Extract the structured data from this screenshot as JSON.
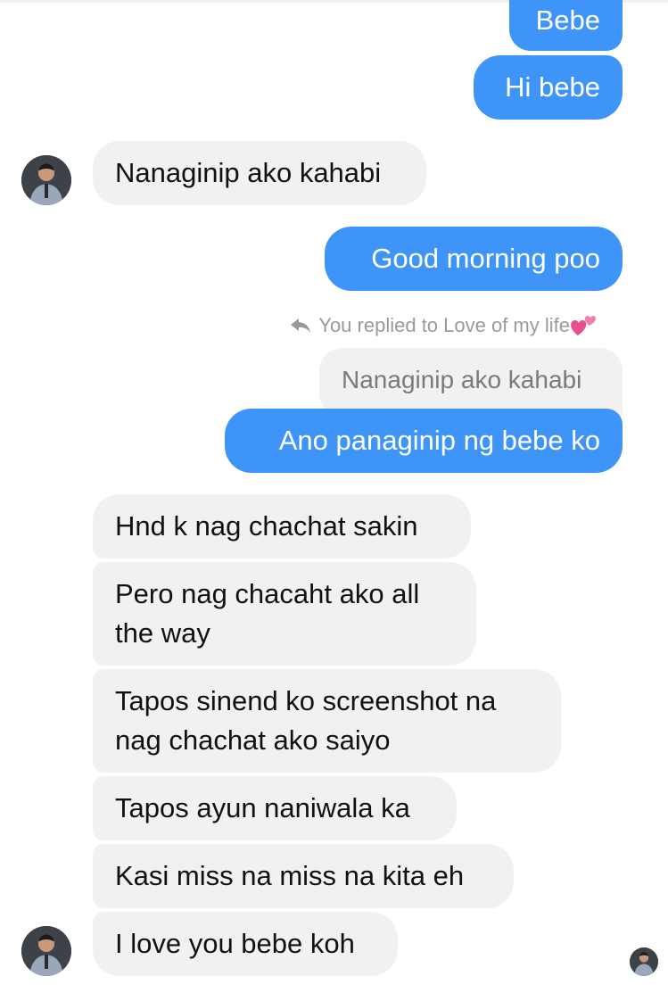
{
  "conversation": {
    "sent_top": [
      "Bebe",
      "Hi bebe"
    ],
    "received_1": "Nanaginip ako kahabi",
    "sent_2": "Good morning poo",
    "reply_note": "You replied to Love of my life",
    "reply_note_emoji": "heart-icon",
    "quoted_message": "Nanaginip ako kahabi",
    "reply_message": "Ano panaginip ng bebe ko",
    "received_group": [
      "Hnd k nag chachat sakin",
      "Pero nag chacaht ako all",
      "the way",
      "Tapos sinend ko screenshot na",
      "nag chachat ako saiyo",
      "Tapos ayun naniwala ka",
      "Kasi miss na miss na kita eh",
      "I love you bebe koh"
    ]
  },
  "colors": {
    "outgoing": "#3e95f7",
    "incoming": "#f1f1f1",
    "meta": "#9a9a9a"
  }
}
